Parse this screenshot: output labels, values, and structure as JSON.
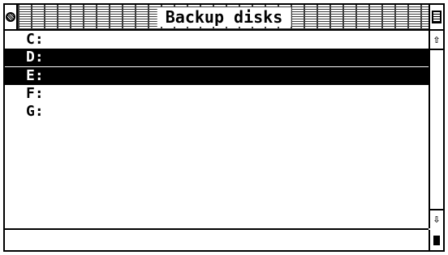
{
  "window": {
    "title": "Backup disks"
  },
  "drives": [
    {
      "label": "C:",
      "selected": false
    },
    {
      "label": "D:",
      "selected": true
    },
    {
      "label": "E:",
      "selected": true
    },
    {
      "label": "F:",
      "selected": false
    },
    {
      "label": "G:",
      "selected": false
    }
  ],
  "icons": {
    "close": "close-box-icon",
    "full": "full-box-icon",
    "up": "up-arrow-icon",
    "down": "down-arrow-icon",
    "size": "size-box-icon"
  },
  "glyphs": {
    "up": "⇧",
    "down": "⇩"
  },
  "colors": {
    "foreground": "#000000",
    "background": "#ffffff",
    "selection": "#000000"
  }
}
